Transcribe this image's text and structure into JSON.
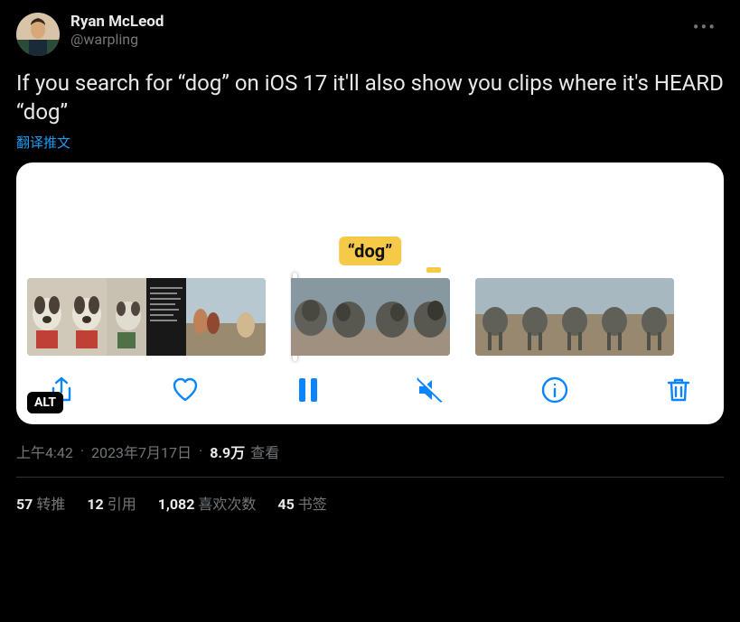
{
  "author": {
    "name": "Ryan McLeod",
    "handle": "@warpling"
  },
  "tweet_text": "If you search for “dog” on iOS 17 it'll also show you clips where it's HEARD “dog”",
  "translate_label": "翻译推文",
  "search_term": "“dog”",
  "alt_badge": "ALT",
  "meta": {
    "time": "上午4:42",
    "date": "2023年7月17日",
    "views_count": "8.9万",
    "views_label": "查看"
  },
  "stats": {
    "retweets_count": "57",
    "retweets_label": "转推",
    "quotes_count": "12",
    "quotes_label": "引用",
    "likes_count": "1,082",
    "likes_label": "喜欢次数",
    "bookmarks_count": "45",
    "bookmarks_label": "书签"
  }
}
